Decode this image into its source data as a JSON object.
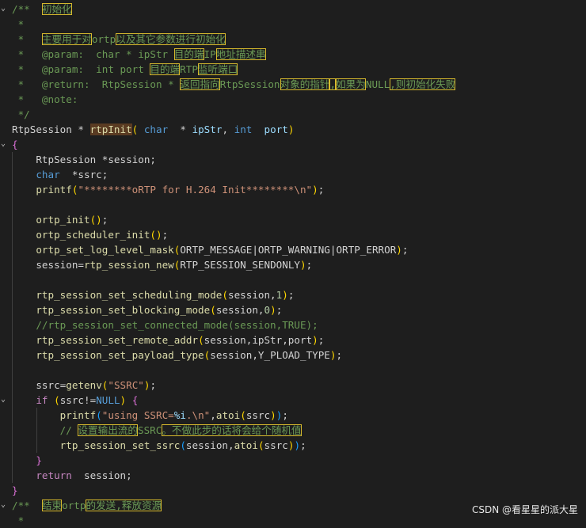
{
  "code": {
    "l1_open": "/**",
    "l1_title": "初始化",
    "l2": " *",
    "l3_star": " *   ",
    "l3_a": "主要用于对",
    "l3_b": "ortp",
    "l3_c": "以及其它参数进行初始化",
    "l4_star": " *   @param:  char * ipStr ",
    "l4_a": "目的端",
    "l4_b": "IP",
    "l4_c": "地址描述串",
    "l5_star": " *   @param:  int port ",
    "l5_a": "目的端",
    "l5_b": "RTP",
    "l5_c": "监听端口",
    "l6_star": " *   @return:  RtpSession * ",
    "l6_a": "返回指向",
    "l6_b": "RtpSession",
    "l6_c": "对象的指针",
    "l6_d": ",",
    "l6_e": "如果为",
    "l6_f": "NULL",
    "l6_g": ",则初始化失败",
    "l7": " *   @note:",
    "l8": " */",
    "l9_type": "RtpSession",
    "l9_star": " * ",
    "l9_fn": "rtpInit",
    "l9_lp": "(",
    "l9_char": " char",
    "l9_mid": "  * ",
    "l9_ip": "ipStr",
    "l9_comma": ", ",
    "l9_int": "int",
    "l9_port": "  port",
    "l9_rp": ")",
    "l10": "{",
    "l11_type": "RtpSession",
    "l11_rest": " *session;",
    "l12_char": "char",
    "l12_rest": "  *ssrc;",
    "l13_fn": "printf",
    "l13_lp": "(",
    "l13_str": "\"********oRTP for H.264 Init********\\n\"",
    "l13_rp": ")",
    "l13_end": ";",
    "l15_fn": "ortp_init",
    "l15_par": "()",
    "l15_end": ";",
    "l16_fn": "ortp_scheduler_init",
    "l16_par": "()",
    "l16_end": ";",
    "l17_fn": "ortp_set_log_level_mask",
    "l17_lp": "(",
    "l17_args": "ORTP_MESSAGE|ORTP_WARNING|ORTP_ERROR",
    "l17_rp": ")",
    "l17_end": ";",
    "l18_var": "session",
    "l18_eq": "=",
    "l18_fn": "rtp_session_new",
    "l18_lp": "(",
    "l18_arg": "RTP_SESSION_SENDONLY",
    "l18_rp": ")",
    "l18_end": ";",
    "l20_fn": "rtp_session_set_scheduling_mode",
    "l20_lp": "(",
    "l20_a": "session,",
    "l20_n": "1",
    "l20_rp": ")",
    "l20_end": ";",
    "l21_fn": "rtp_session_set_blocking_mode",
    "l21_lp": "(",
    "l21_a": "session,",
    "l21_n": "0",
    "l21_rp": ")",
    "l21_end": ";",
    "l22": "//rtp_session_set_connected_mode(session,TRUE);",
    "l23_fn": "rtp_session_set_remote_addr",
    "l23_lp": "(",
    "l23_a": "session,ipStr,port",
    "l23_rp": ")",
    "l23_end": ";",
    "l24_fn": "rtp_session_set_payload_type",
    "l24_lp": "(",
    "l24_a": "session,Y_PLOAD_TYPE",
    "l24_rp": ")",
    "l24_end": ";",
    "l26_var": "ssrc",
    "l26_eq": "=",
    "l26_fn": "getenv",
    "l26_lp": "(",
    "l26_str": "\"SSRC\"",
    "l26_rp": ")",
    "l26_end": ";",
    "l27_if": "if",
    "l27_lp": " (",
    "l27_a": "ssrc!=",
    "l27_null": "NULL",
    "l27_rp": ")",
    "l27_br": " {",
    "l28_fn": "printf",
    "l28_lp": "(",
    "l28_str1": "\"using SSRC=",
    "l28_fmt": "%i",
    "l28_str2": ".\\n\"",
    "l28_comma": ",",
    "l28_fn2": "atoi",
    "l28_lp2": "(",
    "l28_arg": "ssrc",
    "l28_rp2": ")",
    "l28_rp": ")",
    "l28_end": ";",
    "l29_pre": "// ",
    "l29_a": "设置输出流的",
    "l29_b": "SSRC",
    "l29_c": "。不做此步的话将会给个随机值",
    "l30_fn": "rtp_session_set_ssrc",
    "l30_lp": "(",
    "l30_a": "session,",
    "l30_fn2": "atoi",
    "l30_lp2": "(",
    "l30_arg": "ssrc",
    "l30_rp2": ")",
    "l30_rp": ")",
    "l30_end": ";",
    "l31": "}",
    "l32_ret": "return",
    "l32_rest": "  session;",
    "l33": "}",
    "l34_open": "/**",
    "l34_a": "结束",
    "l34_b": "ortp",
    "l34_c": "的发送,释放资源",
    "l35": " *"
  },
  "watermark": "CSDN @看星星的派大星",
  "colors": {
    "background": "#1e1e1e",
    "comment": "#6a9955",
    "keyword": "#569cd6",
    "function": "#dcdcaa",
    "string": "#ce9178",
    "highlight_border": "#d7ba2d"
  }
}
